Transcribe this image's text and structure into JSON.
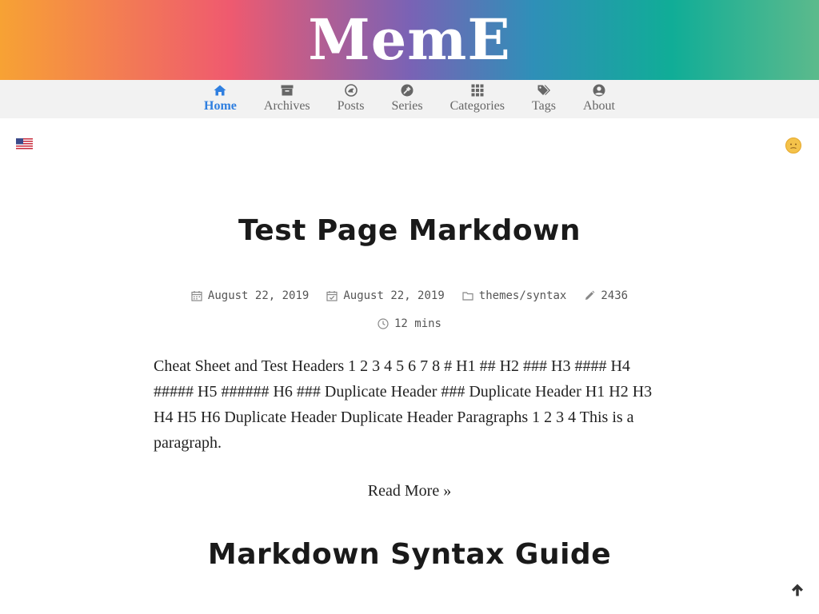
{
  "site": {
    "title": "MemE"
  },
  "nav": {
    "items": [
      {
        "label": "Home",
        "icon": "home-icon",
        "active": true
      },
      {
        "label": "Archives",
        "icon": "archive-icon",
        "active": false
      },
      {
        "label": "Posts",
        "icon": "compass-icon",
        "active": false
      },
      {
        "label": "Series",
        "icon": "series-icon",
        "active": false
      },
      {
        "label": "Categories",
        "icon": "grid-icon",
        "active": false
      },
      {
        "label": "Tags",
        "icon": "tags-icon",
        "active": false
      },
      {
        "label": "About",
        "icon": "user-circle-icon",
        "active": false
      }
    ],
    "active_color": "#2f7fe0"
  },
  "language": {
    "icon": "us-flag-icon"
  },
  "theme_toggle": {
    "icon": "sun-icon"
  },
  "posts": [
    {
      "title": "Test Page Markdown",
      "published": "August 22, 2019",
      "updated": "August 22, 2019",
      "category": "themes/syntax",
      "word_count": "2436",
      "reading_time": "12 mins",
      "summary": "Cheat Sheet and Test Headers 1 2 3 4 5 6 7 8 # H1 ## H2 ### H3 #### H4 ##### H5 ###### H6 ### Duplicate Header ### Duplicate Header H1 H2 H3 H4 H5 H6 Duplicate Header Duplicate Header Paragraphs 1 2 3 4 This is a paragraph.",
      "read_more": "Read More »"
    },
    {
      "title": "Markdown Syntax Guide"
    }
  ],
  "back_to_top": {
    "icon": "arrow-up-icon"
  }
}
